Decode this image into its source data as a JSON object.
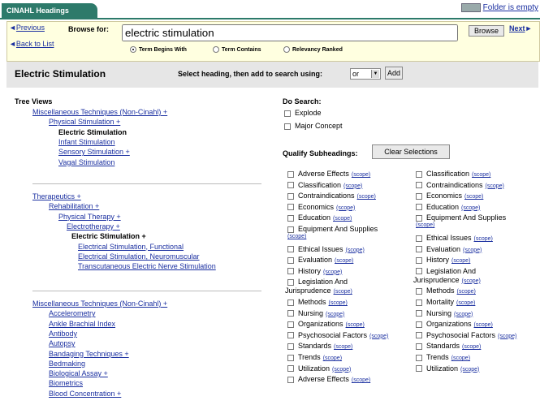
{
  "tab": {
    "label": "CINAHL Headings"
  },
  "folder_link": "Folder is empty",
  "browse": {
    "previous": "Previous",
    "back": "Back to List",
    "next": "Next",
    "label": "Browse for:",
    "value": "electric stimulation",
    "button": "Browse",
    "options": [
      "Term Begins With",
      "Term Contains",
      "Relevancy Ranked"
    ],
    "selected": 0
  },
  "header": {
    "title": "Electric Stimulation",
    "instruction": "Select heading, then add to search using:",
    "operator": "or",
    "add_button": "Add"
  },
  "tree": {
    "title": "Tree Views",
    "group1": [
      {
        "text": "Miscellaneous Techniques (Non-Cinahl) +",
        "level": 0,
        "link": true
      },
      {
        "text": "Physical Stimulation +",
        "level": 1,
        "link": true
      },
      {
        "text": "Electric Stimulation",
        "level": 2,
        "link": false,
        "bold": true
      },
      {
        "text": "Infant Stimulation",
        "level": 2,
        "link": true
      },
      {
        "text": "Sensory Stimulation +",
        "level": 2,
        "link": true
      },
      {
        "text": "Vagal Stimulation",
        "level": 2,
        "link": true
      }
    ],
    "group2": [
      {
        "text": "Therapeutics +",
        "level": 0,
        "link": true
      },
      {
        "text": "Rehabilitation +",
        "level": 1,
        "link": true
      },
      {
        "text": "Physical Therapy +",
        "level": 2,
        "link": true
      },
      {
        "text": "Electrotherapy +",
        "level": 3,
        "link": true
      },
      {
        "text": "Electric Stimulation +",
        "level": 4,
        "link": false,
        "bold": true
      },
      {
        "text": "Electrical Stimulation, Functional",
        "level": 5,
        "link": true
      },
      {
        "text": "Electrical Stimulation, Neuromuscular",
        "level": 5,
        "link": true
      },
      {
        "text": "Transcutaneous Electric Nerve Stimulation",
        "level": 5,
        "link": true
      }
    ],
    "group3": [
      {
        "text": "Miscellaneous Techniques (Non-Cinahl) +",
        "level": 0,
        "link": true
      },
      {
        "text": "Accelerometry",
        "level": 1,
        "link": true
      },
      {
        "text": "Ankle Brachial Index",
        "level": 1,
        "link": true
      },
      {
        "text": "Antibody",
        "level": 1,
        "link": true
      },
      {
        "text": "Autopsy",
        "level": 1,
        "link": true
      },
      {
        "text": "Bandaging Techniques +",
        "level": 1,
        "link": true
      },
      {
        "text": "Bedmaking",
        "level": 1,
        "link": true
      },
      {
        "text": "Biological Assay +",
        "level": 1,
        "link": true
      },
      {
        "text": "Biometrics",
        "level": 1,
        "link": true
      },
      {
        "text": "Blood Concentration +",
        "level": 1,
        "link": true
      }
    ]
  },
  "do_search": {
    "title": "Do Search:",
    "options": [
      "Explode",
      "Major Concept"
    ]
  },
  "qualify": {
    "title": "Qualify Subheadings:",
    "clear_button": "Clear Selections",
    "scope": "(scope)",
    "col1": [
      {
        "label": "Adverse Effects",
        "scope": true
      },
      {
        "label": "Classification",
        "scope": true
      },
      {
        "label": "Contraindications",
        "scope": true
      },
      {
        "label": "Economics",
        "scope": true
      },
      {
        "label": "Education",
        "scope": true
      },
      {
        "label": "Equipment And Supplies",
        "scope": true,
        "wrap": true
      },
      {
        "label": "Ethical Issues",
        "scope": true
      },
      {
        "label": "Evaluation",
        "scope": true
      },
      {
        "label": "History",
        "scope": true
      },
      {
        "label": "Legislation And Jurisprudence",
        "scope": true,
        "wrap": true,
        "cont": "Jurisprudence"
      },
      {
        "label": "Methods",
        "scope": true
      },
      {
        "label": "Nursing",
        "scope": true
      },
      {
        "label": "Organizations",
        "scope": true
      },
      {
        "label": "Psychosocial Factors",
        "scope": true
      },
      {
        "label": "Standards",
        "scope": true
      },
      {
        "label": "Trends",
        "scope": true
      },
      {
        "label": "Utilization",
        "scope": true
      },
      {
        "label": "Adverse Effects",
        "scope": true
      }
    ],
    "col2": [
      {
        "label": "Classification",
        "scope": true
      },
      {
        "label": "Contraindications",
        "scope": true
      },
      {
        "label": "Economics",
        "scope": true
      },
      {
        "label": "Education",
        "scope": true
      },
      {
        "label": "Equipment And Supplies",
        "scope": true,
        "wrap": true
      },
      {
        "label": "Ethical Issues",
        "scope": true
      },
      {
        "label": "Evaluation",
        "scope": true
      },
      {
        "label": "History",
        "scope": true
      },
      {
        "label": "Legislation And Jurisprudence",
        "scope": true,
        "wrap": true,
        "cont": "Jurisprudence"
      },
      {
        "label": "Methods",
        "scope": true
      },
      {
        "label": "Mortality",
        "scope": true
      },
      {
        "label": "Nursing",
        "scope": true
      },
      {
        "label": "Organizations",
        "scope": true
      },
      {
        "label": "Psychosocial Factors",
        "scope": true
      },
      {
        "label": "Standards",
        "scope": true
      },
      {
        "label": "Trends",
        "scope": true
      },
      {
        "label": "Utilization",
        "scope": true
      }
    ]
  },
  "colors": {
    "tab": "#2d7a6a",
    "link": "#1a2fa0",
    "panel": "#ffffe0",
    "header": "#e6e6e6"
  }
}
